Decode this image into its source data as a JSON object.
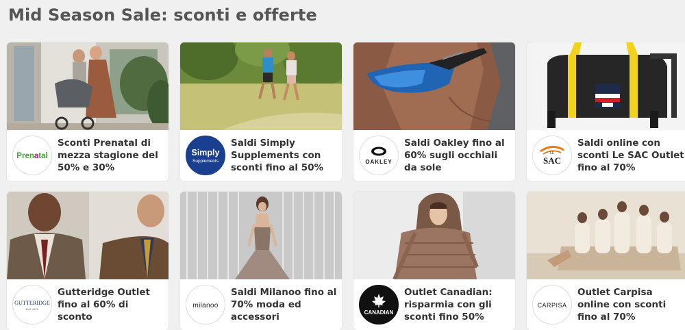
{
  "page": {
    "title": "Mid Season Sale: sconti e offerte"
  },
  "cards": [
    {
      "brand": "Prenatal",
      "logo_text": "Prenatal",
      "description": "Sconti Prenatal di mezza stagione del 50% e 30%"
    },
    {
      "brand": "Simply Supplements",
      "logo_text": "Simply",
      "logo_subtext": "Supplements",
      "description": "Saldi Simply Supplements con sconti fino al 50%"
    },
    {
      "brand": "Oakley",
      "logo_text": "OAKLEY",
      "description": "Saldi Oakley fino al 60% sugli occhiali da sole"
    },
    {
      "brand": "Le SAC Outlet",
      "logo_text": "SAC",
      "logo_subtext": "LE",
      "description": "Saldi online con sconti Le SAC Outlet fino al 70%"
    },
    {
      "brand": "Gutteridge",
      "logo_text": "GUTTERIDGE",
      "logo_subtext": "DAL 1878",
      "description": "Gutteridge Outlet fino al 60% di sconto"
    },
    {
      "brand": "Milanoo",
      "logo_text": "milanoo",
      "description": "Saldi Milanoo fino al 70% moda ed accessori"
    },
    {
      "brand": "Canadian",
      "logo_text": "CANADIAN",
      "description": "Outlet Canadian: risparmia con gli sconti fino 50%"
    },
    {
      "brand": "Carpisa",
      "logo_text": "CARPISA",
      "description": "Outlet Carpisa online con sconti fino al 70%"
    }
  ],
  "colors": {
    "background": "#f0f0f0",
    "card": "#ffffff",
    "title": "#555555",
    "text": "#333333",
    "prenatal_green": "#3aa935",
    "prenatal_pink": "#e6007e",
    "simply_blue": "#1b3f8f",
    "canadian_black": "#111111"
  }
}
